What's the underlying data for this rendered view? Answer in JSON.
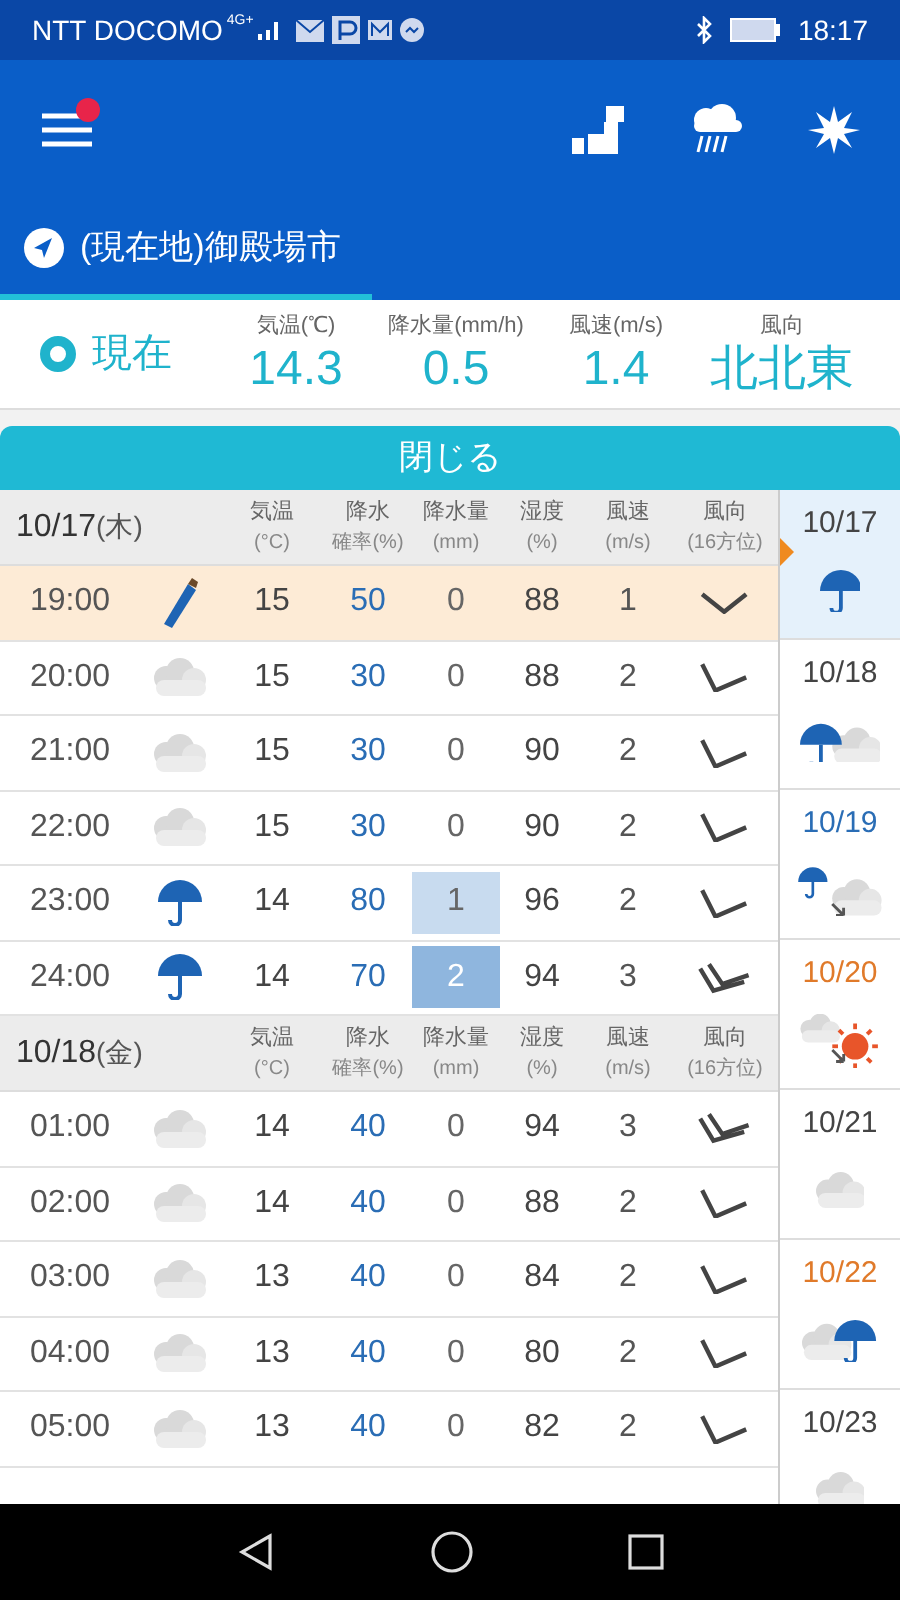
{
  "status_bar": {
    "carrier": "NTT DOCOMO",
    "network": "4G+",
    "time": "18:17"
  },
  "header": {
    "menu_badge": true,
    "location_tab": {
      "label": "(現在地)御殿場市",
      "selected": true
    }
  },
  "current": {
    "label": "現在",
    "metrics": [
      {
        "label": "気温(℃)",
        "value": "14.3"
      },
      {
        "label": "降水量(mm/h)",
        "value": "0.5"
      },
      {
        "label": "風速(m/s)",
        "value": "1.4"
      },
      {
        "label": "風向",
        "value": "北北東"
      }
    ]
  },
  "close_button": "閉じる",
  "sections": [
    {
      "date": "10/17",
      "weekday": "(木)",
      "columns": [
        {
          "line1": "気温",
          "line2": "(°C)"
        },
        {
          "line1": "降水",
          "line2": "確率(%)"
        },
        {
          "line1": "降水量",
          "line2": "(mm)"
        },
        {
          "line1": "湿度",
          "line2": "(%)"
        },
        {
          "line1": "風速",
          "line2": "(m/s)"
        },
        {
          "line1": "風向",
          "line2": "(16方位)"
        }
      ],
      "rows": [
        {
          "time": "19:00",
          "weather": {
            "kind": "closed-umbrella"
          },
          "temp": "15",
          "pop": "50",
          "rain": "0",
          "humidity": "88",
          "wind": "1",
          "wind_mark": {
            "kind": "down"
          },
          "selected": true
        },
        {
          "time": "20:00",
          "weather": {
            "kind": "cloud"
          },
          "temp": "15",
          "pop": "30",
          "rain": "0",
          "humidity": "88",
          "wind": "2",
          "wind_mark": {
            "kind": "single"
          },
          "selected": false
        },
        {
          "time": "21:00",
          "weather": {
            "kind": "cloud"
          },
          "temp": "15",
          "pop": "30",
          "rain": "0",
          "humidity": "90",
          "wind": "2",
          "wind_mark": {
            "kind": "single"
          },
          "selected": false
        },
        {
          "time": "22:00",
          "weather": {
            "kind": "cloud"
          },
          "temp": "15",
          "pop": "30",
          "rain": "0",
          "humidity": "90",
          "wind": "2",
          "wind_mark": {
            "kind": "single"
          },
          "selected": false
        },
        {
          "time": "23:00",
          "weather": {
            "kind": "umbrella"
          },
          "temp": "14",
          "pop": "80",
          "rain": "1",
          "color": "#c8dbef",
          "humidity": "96",
          "wind": "2",
          "wind_mark": {
            "kind": "single"
          },
          "selected": false
        },
        {
          "time": "24:00",
          "weather": {
            "kind": "umbrella"
          },
          "temp": "14",
          "pop": "70",
          "rain": "2",
          "color": "#8fb6de",
          "humidity": "94",
          "wind": "3",
          "wind_mark": {
            "kind": "double"
          },
          "selected": false
        }
      ]
    },
    {
      "date": "10/18",
      "weekday": "(金)",
      "columns": [
        {
          "line1": "気温",
          "line2": "(°C)"
        },
        {
          "line1": "降水",
          "line2": "確率(%)"
        },
        {
          "line1": "降水量",
          "line2": "(mm)"
        },
        {
          "line1": "湿度",
          "line2": "(%)"
        },
        {
          "line1": "風速",
          "line2": "(m/s)"
        },
        {
          "line1": "風向",
          "line2": "(16方位)"
        }
      ],
      "rows": [
        {
          "time": "01:00",
          "weather": {
            "kind": "cloud"
          },
          "temp": "14",
          "pop": "40",
          "rain": "0",
          "humidity": "94",
          "wind": "3",
          "wind_mark": {
            "kind": "double"
          },
          "selected": false
        },
        {
          "time": "02:00",
          "weather": {
            "kind": "cloud"
          },
          "temp": "14",
          "pop": "40",
          "rain": "0",
          "humidity": "88",
          "wind": "2",
          "wind_mark": {
            "kind": "single"
          },
          "selected": false
        },
        {
          "time": "03:00",
          "weather": {
            "kind": "cloud"
          },
          "temp": "13",
          "pop": "40",
          "rain": "0",
          "humidity": "84",
          "wind": "2",
          "wind_mark": {
            "kind": "single"
          },
          "selected": false
        },
        {
          "time": "04:00",
          "weather": {
            "kind": "cloud"
          },
          "temp": "13",
          "pop": "40",
          "rain": "0",
          "humidity": "80",
          "wind": "2",
          "wind_mark": {
            "kind": "single"
          },
          "selected": false
        },
        {
          "time": "05:00",
          "weather": {
            "kind": "cloud"
          },
          "temp": "13",
          "pop": "40",
          "rain": "0",
          "humidity": "82",
          "wind": "2",
          "wind_mark": {
            "kind": "single"
          },
          "selected": false
        }
      ]
    }
  ],
  "days": [
    {
      "date": "10/17",
      "color": "#444444",
      "weather": {
        "kind": "umbrella"
      },
      "selected": true
    },
    {
      "date": "10/18",
      "color": "#444444",
      "weather": {
        "kind": "umbrella-cloud"
      },
      "selected": false
    },
    {
      "date": "10/19",
      "color": "#2a6db5",
      "weather": {
        "kind": "umbrella-to-cloud"
      },
      "selected": false
    },
    {
      "date": "10/20",
      "color": "#e07a2a",
      "weather": {
        "kind": "cloud-to-sun"
      },
      "selected": false
    },
    {
      "date": "10/21",
      "color": "#444444",
      "weather": {
        "kind": "cloud"
      },
      "selected": false
    },
    {
      "date": "10/22",
      "color": "#e07a2a",
      "weather": {
        "kind": "cloud-umbrella"
      },
      "selected": false
    },
    {
      "date": "10/23",
      "color": "#444444",
      "weather": {
        "kind": "cloud"
      },
      "selected": false
    }
  ]
}
